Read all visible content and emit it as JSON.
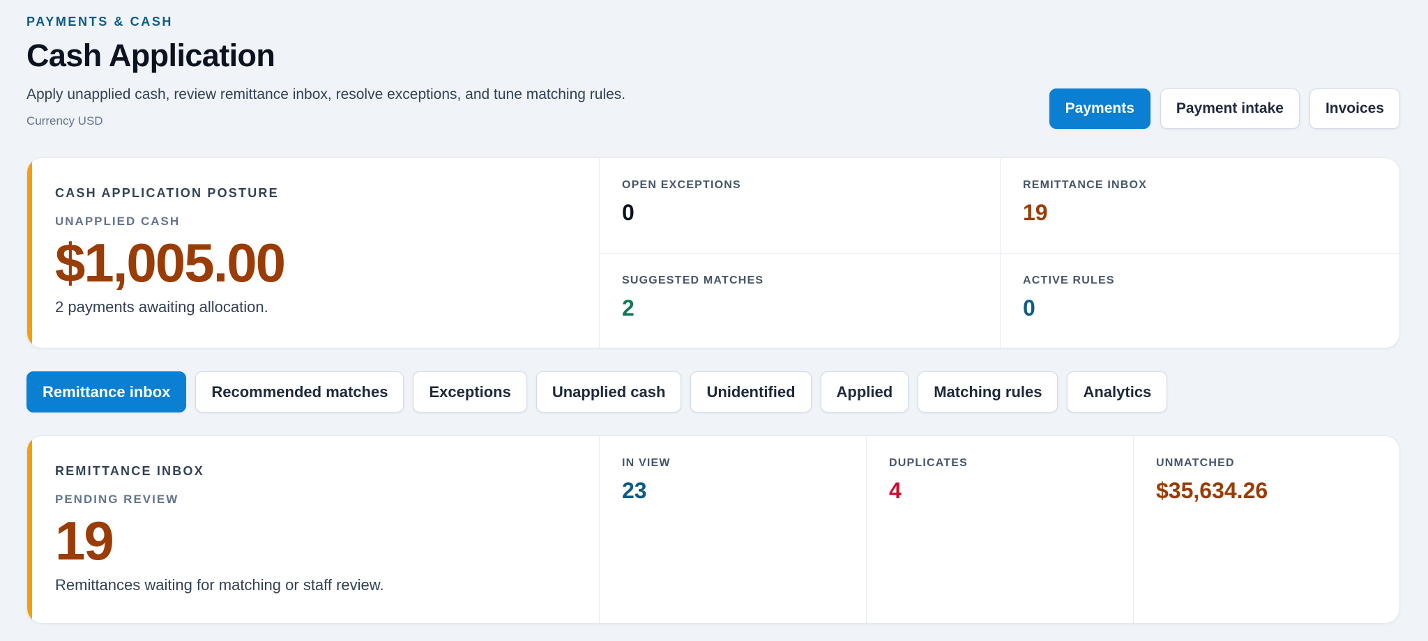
{
  "header": {
    "eyebrow": "PAYMENTS & CASH",
    "title": "Cash Application",
    "subtitle": "Apply unapplied cash, review remittance inbox, resolve exceptions, and tune matching rules.",
    "currency": "Currency USD"
  },
  "actions": {
    "payments": "Payments",
    "payment_intake": "Payment intake",
    "invoices": "Invoices"
  },
  "posture": {
    "label": "CASH APPLICATION POSTURE",
    "sublabel": "UNAPPLIED CASH",
    "value": "$1,005.00",
    "description": "2 payments awaiting allocation.",
    "stats": [
      {
        "label": "OPEN EXCEPTIONS",
        "value": "0",
        "color": "#0b1220"
      },
      {
        "label": "REMITTANCE INBOX",
        "value": "19",
        "color": "#9a3c06"
      },
      {
        "label": "SUGGESTED MATCHES",
        "value": "2",
        "color": "#0f7a57"
      },
      {
        "label": "ACTIVE RULES",
        "value": "0",
        "color": "#0d5b86"
      }
    ]
  },
  "tabs": [
    {
      "label": "Remittance inbox",
      "active": true
    },
    {
      "label": "Recommended matches",
      "active": false
    },
    {
      "label": "Exceptions",
      "active": false
    },
    {
      "label": "Unapplied cash",
      "active": false
    },
    {
      "label": "Unidentified",
      "active": false
    },
    {
      "label": "Applied",
      "active": false
    },
    {
      "label": "Matching rules",
      "active": false
    },
    {
      "label": "Analytics",
      "active": false
    }
  ],
  "inbox": {
    "label": "REMITTANCE INBOX",
    "sublabel": "PENDING REVIEW",
    "value": "19",
    "description": "Remittances waiting for matching or staff review.",
    "stats": [
      {
        "label": "IN VIEW",
        "value": "23",
        "color": "#0d5b86"
      },
      {
        "label": "DUPLICATES",
        "value": "4",
        "color": "#c8102e"
      },
      {
        "label": "UNMATCHED",
        "value": "$35,634.26",
        "color": "#9a3c06"
      }
    ]
  }
}
